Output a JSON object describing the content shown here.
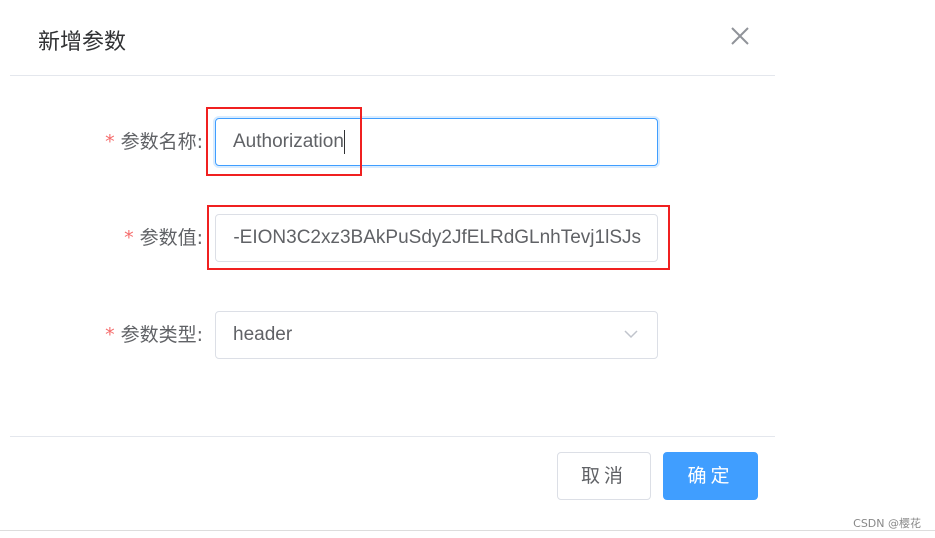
{
  "dialog": {
    "title": "新增参数",
    "close_icon": "close-icon",
    "fields": [
      {
        "label": "参数名称:",
        "required": true,
        "value": "Authorization"
      },
      {
        "label": "参数值:",
        "required": true,
        "value": "-EION3C2xz3BAkPuSdy2JfELRdGLnhTevj1lSJs"
      },
      {
        "label": "参数类型:",
        "required": true,
        "value": "header",
        "icon": "chevron-down-icon"
      }
    ],
    "required_mark": "*",
    "cancel_label": "取消",
    "confirm_label": "确定"
  },
  "colors": {
    "primary": "#409eff",
    "required": "#f56c6c",
    "annotation": "#f02020"
  },
  "watermark": "CSDN @樱花"
}
